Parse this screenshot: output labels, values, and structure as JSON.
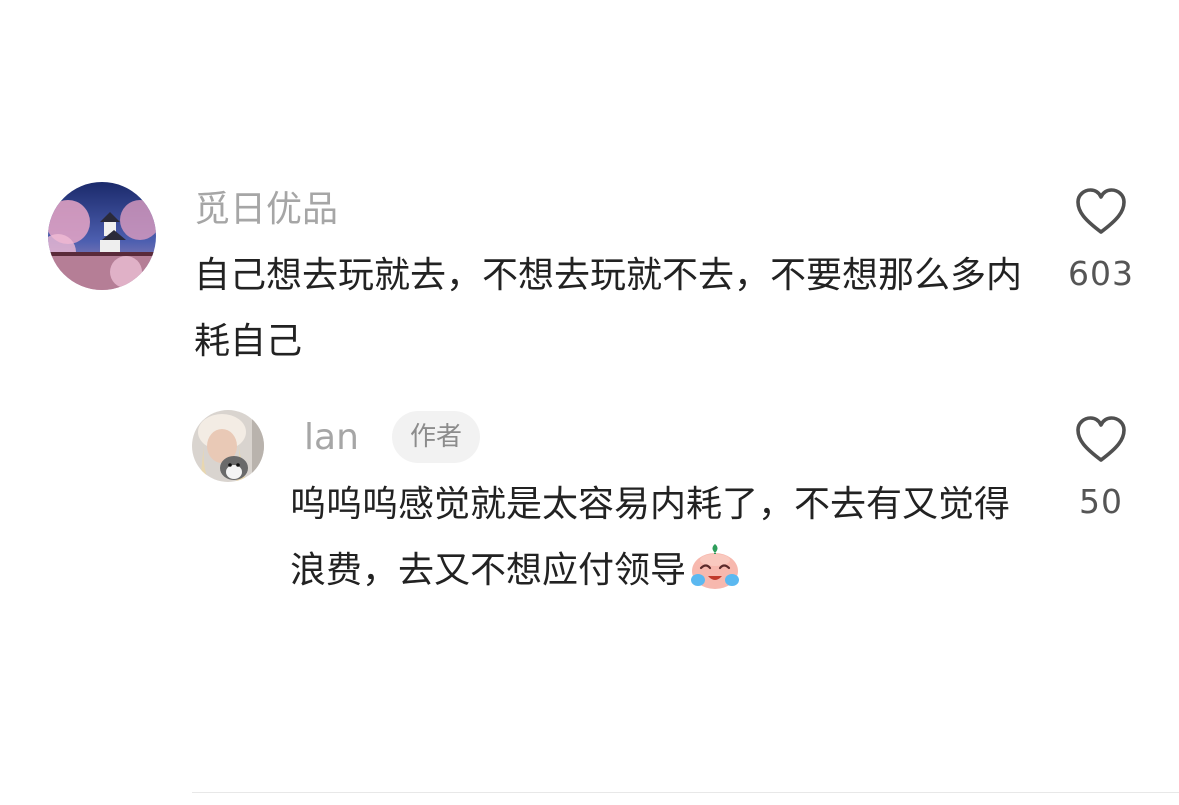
{
  "comments": [
    {
      "username": "觅日优品",
      "text": "自己想去玩就去，不想去玩就不去，不要想那么多内耗自己",
      "likes": "603",
      "avatar_icon": "cherry-blossom-castle-photo"
    }
  ],
  "replies": [
    {
      "username": "lan",
      "badge": "作者",
      "text": "呜呜呜感觉就是太容易内耗了，不去有又觉得浪费，去又不想应付领导",
      "emoji_icon": "crying-face-emoji",
      "likes": "50",
      "avatar_icon": "girl-with-cat-photo"
    }
  ],
  "icons": {
    "like": "heart-outline-icon"
  },
  "colors": {
    "username": "#a6a6a6",
    "text": "#222222",
    "like_count": "#555555",
    "badge_bg": "#f2f2f2"
  }
}
